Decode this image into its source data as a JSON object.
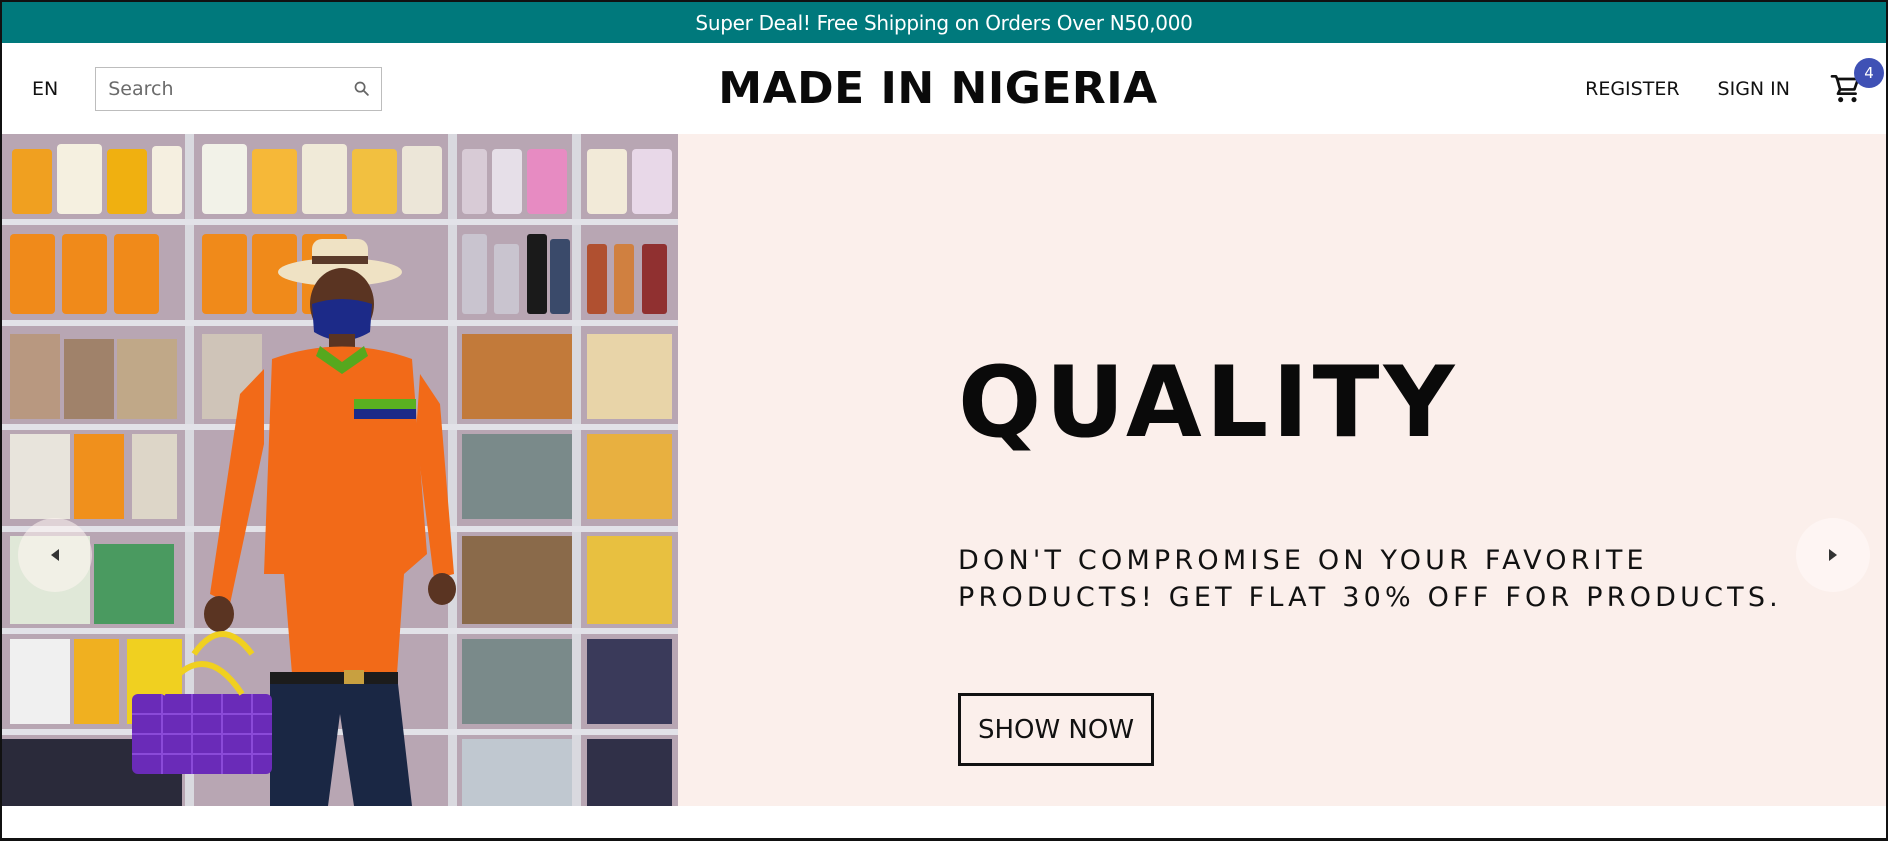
{
  "announcement": {
    "text": "Super Deal! Free Shipping on Orders Over N50,000"
  },
  "navbar": {
    "language": "EN",
    "search": {
      "placeholder": "Search",
      "value": ""
    },
    "logo": "MADE IN NIGERIA",
    "register_label": "REGISTER",
    "signin_label": "SIGN IN",
    "cart_count": "4"
  },
  "slider": {
    "title": "QUALITY",
    "description": "DON'T COMPROMISE ON YOUR FAVORITE PRODUCTS! GET FLAT 30% OFF FOR PRODUCTS.",
    "button_label": "SHOW NOW",
    "background_color": "#fbefeb",
    "prev_icon": "arrow-left-icon",
    "next_icon": "arrow-right-icon"
  },
  "colors": {
    "announcement_bg": "#00797c",
    "badge": "#3f51b5"
  }
}
